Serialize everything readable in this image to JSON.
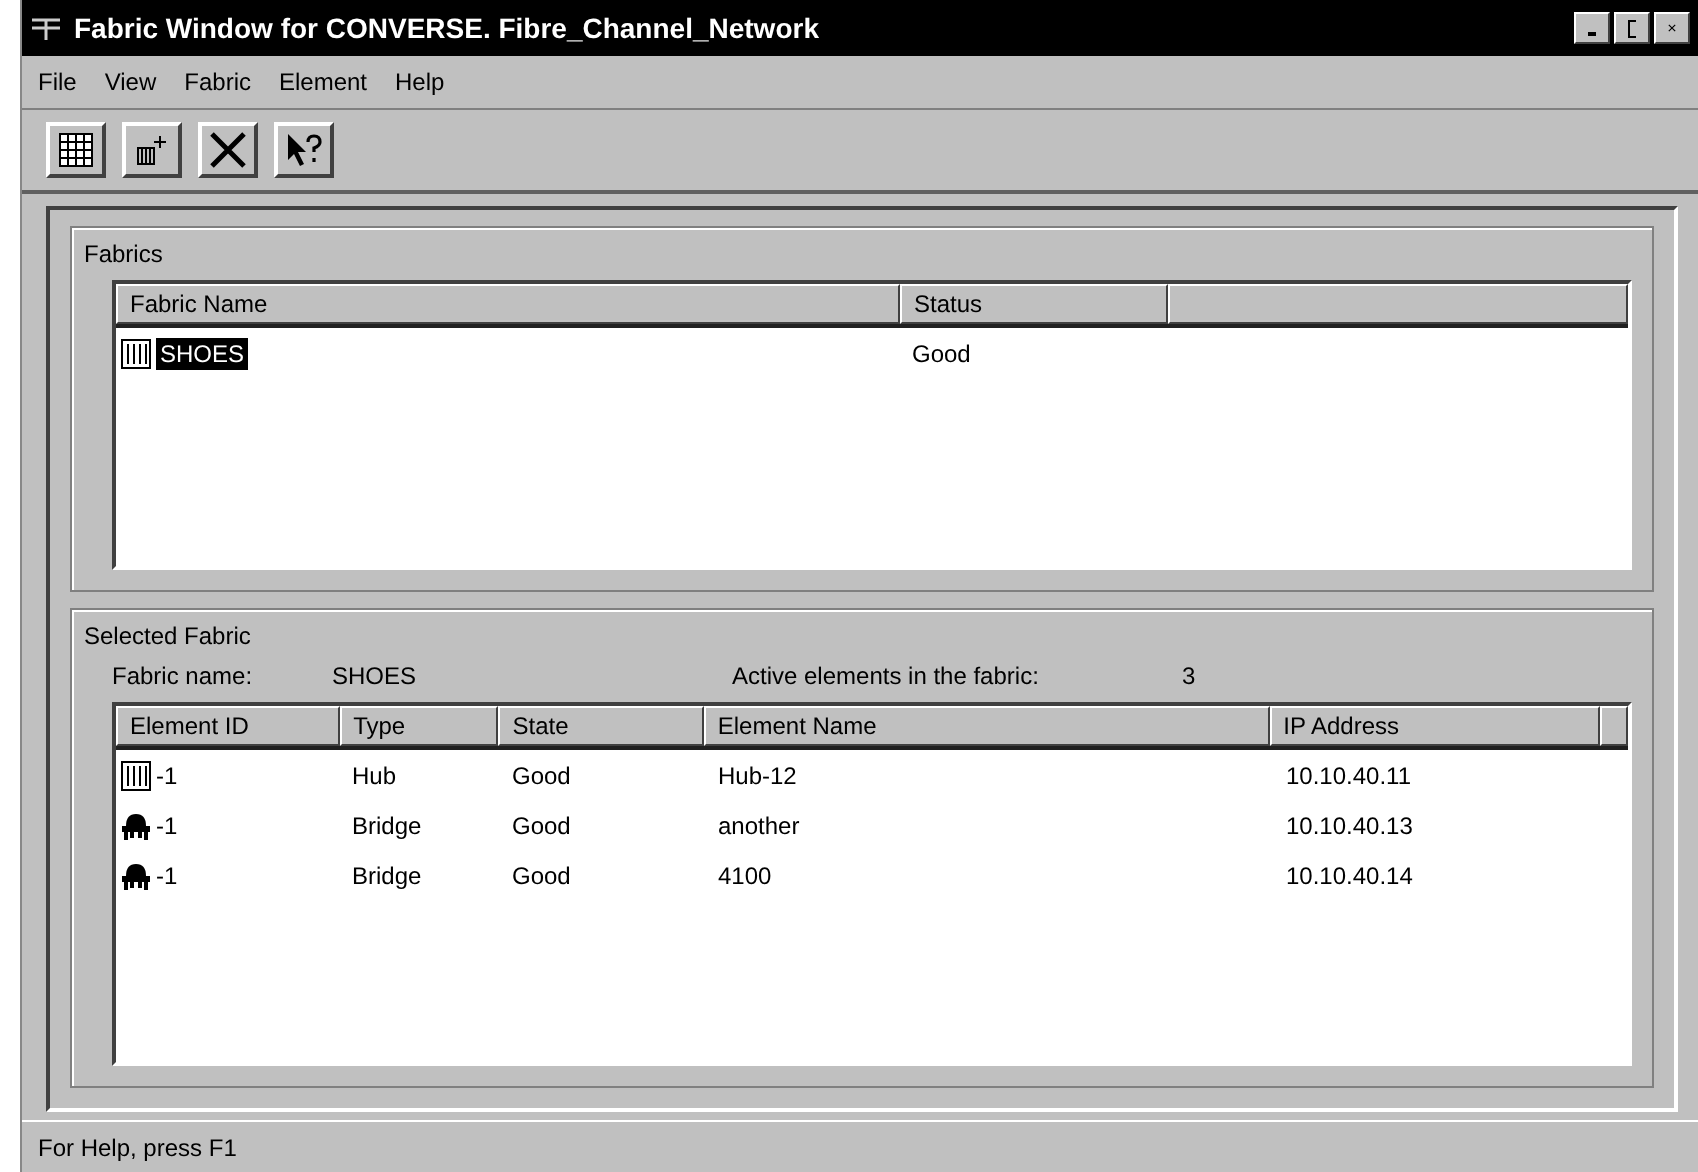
{
  "window": {
    "title": "Fabric Window for CONVERSE. Fibre_Channel_Network"
  },
  "menu": [
    "File",
    "View",
    "Fabric",
    "Element",
    "Help"
  ],
  "toolbar": [
    {
      "kind": "grid"
    },
    {
      "kind": "add"
    },
    {
      "kind": "delete"
    },
    {
      "kind": "help"
    }
  ],
  "fabrics": {
    "title": "Fabrics",
    "columns": [
      "Fabric Name",
      "Status"
    ],
    "rows": [
      {
        "name": "SHOES",
        "status": "Good",
        "selected": true
      }
    ]
  },
  "selected_fabric": {
    "title": "Selected Fabric",
    "name_label": "Fabric name:",
    "name_value": "SHOES",
    "count_label": "Active elements in the fabric:",
    "count_value": "3",
    "columns": [
      "Element ID",
      "Type",
      "State",
      "Element Name",
      "IP Address"
    ],
    "rows": [
      {
        "kind": "hub",
        "id": "-1",
        "type": "Hub",
        "state": "Good",
        "name": "Hub-12",
        "ip": "10.10.40.11"
      },
      {
        "kind": "bridge",
        "id": "-1",
        "type": "Bridge",
        "state": "Good",
        "name": "another",
        "ip": "10.10.40.13"
      },
      {
        "kind": "bridge",
        "id": "-1",
        "type": "Bridge",
        "state": "Good",
        "name": "4100",
        "ip": "10.10.40.14"
      }
    ]
  },
  "status_bar": "For Help, press F1"
}
